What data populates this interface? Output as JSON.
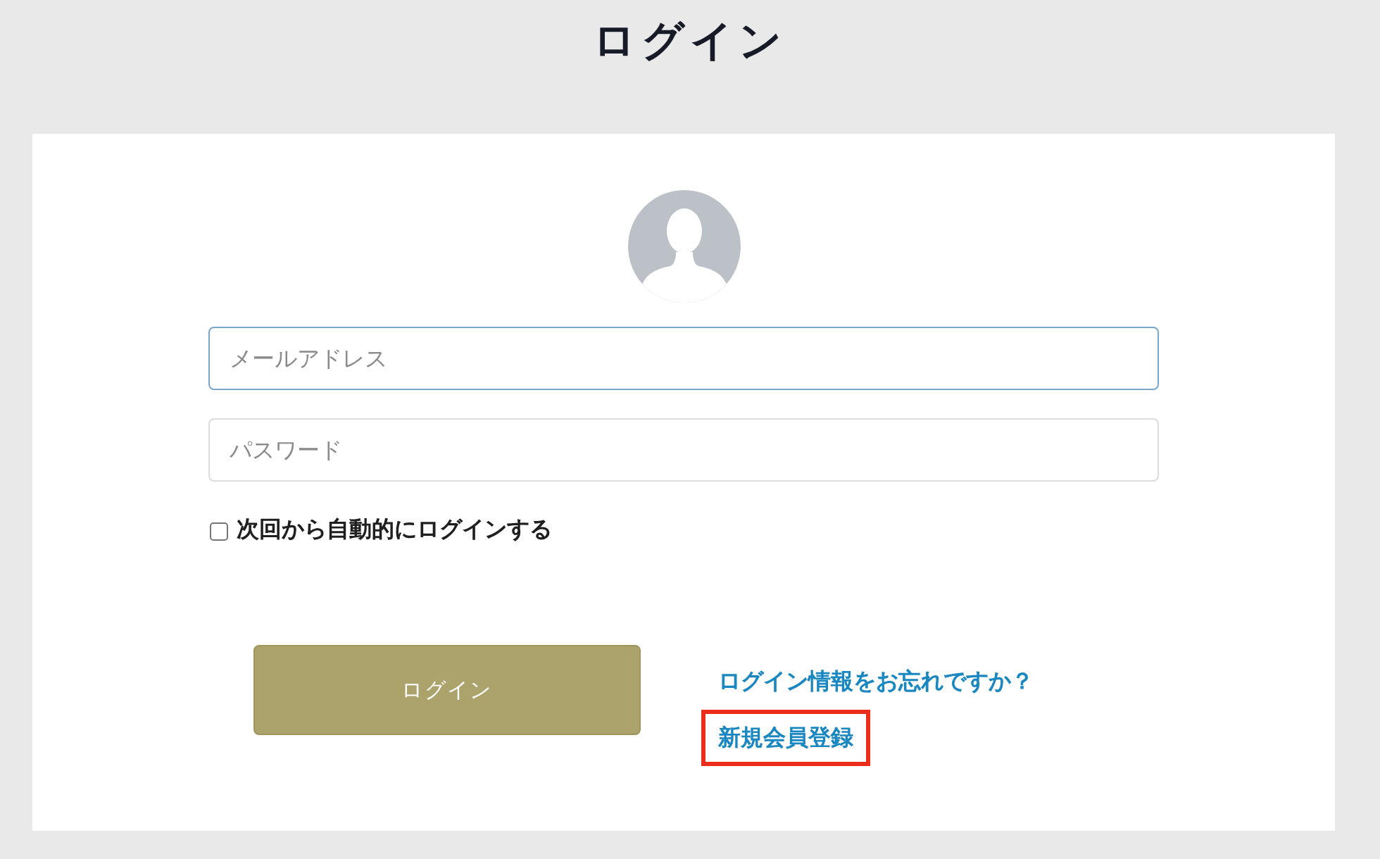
{
  "page": {
    "title": "ログイン"
  },
  "form": {
    "fields": [
      {
        "placeholder": "メールアドレス",
        "focused": true
      },
      {
        "placeholder": "パスワード",
        "focused": false
      }
    ],
    "remember": {
      "label": "次回から自動的にログインする",
      "checked": false
    },
    "submit": {
      "label": "ログイン"
    },
    "links": [
      {
        "label": "ログイン情報をお忘れですか？",
        "highlighted": false
      },
      {
        "label": "新規会員登録",
        "highlighted": true
      }
    ]
  }
}
